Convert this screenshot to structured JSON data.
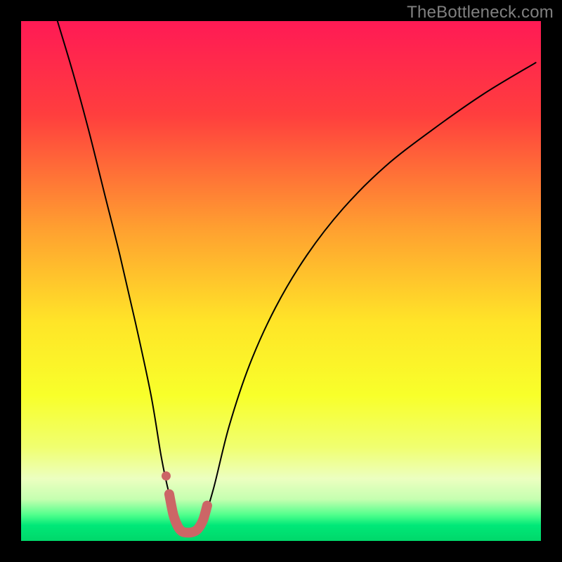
{
  "watermark": "TheBottleneck.com",
  "chart_data": {
    "type": "line",
    "title": "",
    "xlabel": "",
    "ylabel": "",
    "xlim": [
      0,
      100
    ],
    "ylim": [
      0,
      100
    ],
    "gradient_stops": [
      {
        "offset": 0,
        "color": "#ff1a55"
      },
      {
        "offset": 18,
        "color": "#ff3e3e"
      },
      {
        "offset": 40,
        "color": "#ffa030"
      },
      {
        "offset": 58,
        "color": "#ffe528"
      },
      {
        "offset": 72,
        "color": "#f8ff2a"
      },
      {
        "offset": 82,
        "color": "#f0ff70"
      },
      {
        "offset": 88,
        "color": "#ecffc0"
      },
      {
        "offset": 92,
        "color": "#c5ffb0"
      },
      {
        "offset": 95,
        "color": "#50ff8c"
      },
      {
        "offset": 97,
        "color": "#00e878"
      },
      {
        "offset": 100,
        "color": "#00d86a"
      }
    ],
    "series": [
      {
        "name": "bottleneck-curve",
        "x": [
          7,
          10,
          13,
          16,
          19,
          22,
          25,
          27,
          28.5,
          30,
          31.5,
          33,
          35,
          37,
          40,
          44,
          49,
          55,
          62,
          70,
          79,
          89,
          99
        ],
        "y": [
          100,
          90,
          79,
          67,
          55,
          42,
          28,
          16,
          9,
          4,
          2,
          2,
          4,
          10,
          22,
          34,
          45,
          55,
          64,
          72,
          79,
          86,
          92
        ],
        "color": "#000000",
        "width": 2
      },
      {
        "name": "optimal-marker-band",
        "x": [
          28.5,
          29.3,
          30.2,
          31,
          32,
          33,
          34,
          35,
          35.8
        ],
        "y": [
          9,
          5.0,
          2.7,
          1.8,
          1.6,
          1.7,
          2.3,
          4.0,
          6.8
        ],
        "color": "#cc6666",
        "width": 14
      },
      {
        "name": "optimal-marker-dot",
        "type": "scatter",
        "x": [
          27.9
        ],
        "y": [
          12.5
        ],
        "color": "#cc6666",
        "size": 13
      }
    ]
  }
}
